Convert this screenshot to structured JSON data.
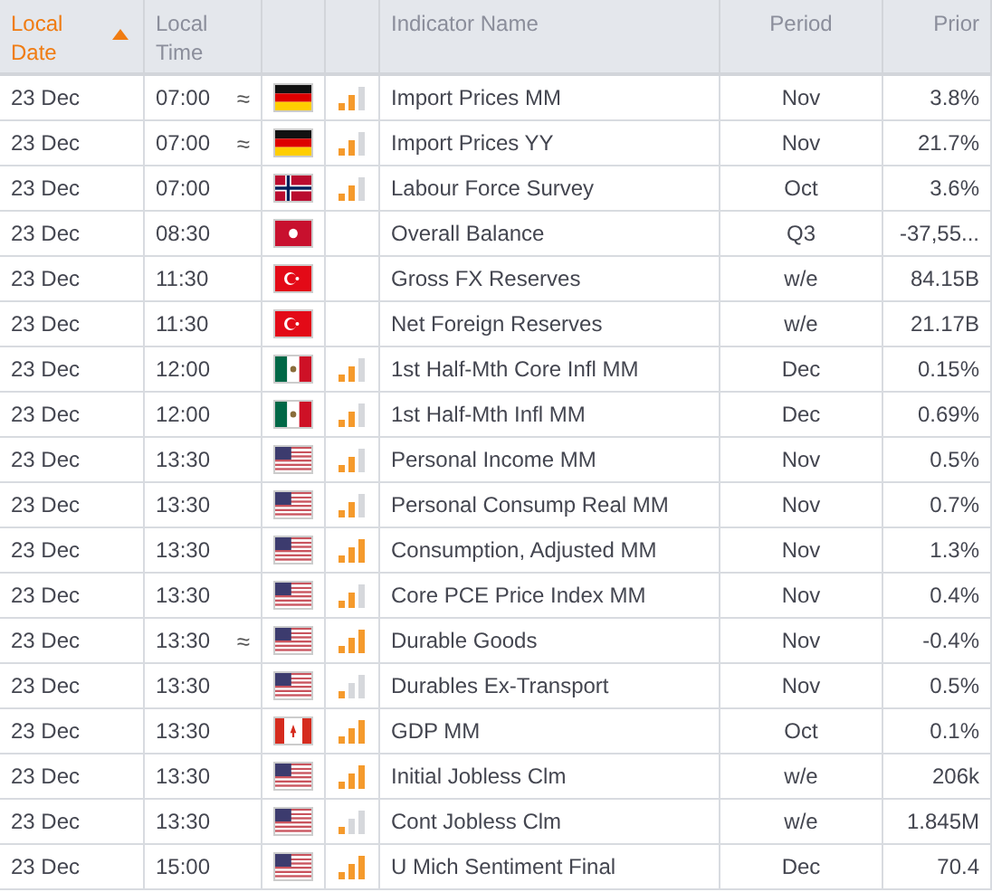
{
  "columns": [
    {
      "label": "Local Date",
      "sorted": true
    },
    {
      "label": "Local Time",
      "sorted": false
    },
    {
      "sorted": false
    },
    {
      "sorted": false
    },
    {
      "label": "Indicator Name",
      "sorted": false
    },
    {
      "label": "Period",
      "sorted": false
    },
    {
      "label": "Prior",
      "sorted": false
    }
  ],
  "rows": [
    {
      "date": "23 Dec",
      "time": "07:00",
      "marker": "≈",
      "flag": {
        "kind": "de"
      },
      "importance": {
        "kind": "medium"
      },
      "name": "Import Prices MM",
      "period": "Nov",
      "prior": "3.8%"
    },
    {
      "date": "23 Dec",
      "time": "07:00",
      "marker": "≈",
      "flag": {
        "kind": "de"
      },
      "importance": {
        "kind": "medium"
      },
      "name": "Import Prices YY",
      "period": "Nov",
      "prior": "21.7%"
    },
    {
      "date": "23 Dec",
      "time": "07:00",
      "flag": {
        "kind": "no"
      },
      "importance": {
        "kind": "medium"
      },
      "name": "Labour Force Survey",
      "period": "Oct",
      "prior": "3.6%"
    },
    {
      "date": "23 Dec",
      "time": "08:30",
      "flag": {
        "kind": "hk"
      },
      "name": "Overall Balance",
      "period": "Q3",
      "prior": "-37,55..."
    },
    {
      "date": "23 Dec",
      "time": "11:30",
      "flag": {
        "kind": "tr"
      },
      "name": "Gross FX Reserves",
      "period": "w/e",
      "prior": "84.15B"
    },
    {
      "date": "23 Dec",
      "time": "11:30",
      "flag": {
        "kind": "tr"
      },
      "name": "Net Foreign Reserves",
      "period": "w/e",
      "prior": "21.17B"
    },
    {
      "date": "23 Dec",
      "time": "12:00",
      "flag": {
        "kind": "mx"
      },
      "importance": {
        "kind": "medium"
      },
      "name": "1st Half-Mth Core Infl MM",
      "period": "Dec",
      "prior": "0.15%"
    },
    {
      "date": "23 Dec",
      "time": "12:00",
      "flag": {
        "kind": "mx"
      },
      "importance": {
        "kind": "medium"
      },
      "name": "1st Half-Mth Infl MM",
      "period": "Dec",
      "prior": "0.69%"
    },
    {
      "date": "23 Dec",
      "time": "13:30",
      "flag": {
        "kind": "us"
      },
      "importance": {
        "kind": "medium"
      },
      "name": "Personal Income MM",
      "period": "Nov",
      "prior": "0.5%"
    },
    {
      "date": "23 Dec",
      "time": "13:30",
      "flag": {
        "kind": "us"
      },
      "importance": {
        "kind": "medium"
      },
      "name": "Personal Consump Real MM",
      "period": "Nov",
      "prior": "0.7%"
    },
    {
      "date": "23 Dec",
      "time": "13:30",
      "flag": {
        "kind": "us"
      },
      "importance": {
        "kind": "high"
      },
      "name": "Consumption, Adjusted MM",
      "period": "Nov",
      "prior": "1.3%"
    },
    {
      "date": "23 Dec",
      "time": "13:30",
      "flag": {
        "kind": "us"
      },
      "importance": {
        "kind": "medium"
      },
      "name": "Core PCE Price Index MM",
      "period": "Nov",
      "prior": "0.4%"
    },
    {
      "date": "23 Dec",
      "time": "13:30",
      "marker": "≈",
      "flag": {
        "kind": "us"
      },
      "importance": {
        "kind": "high"
      },
      "name": "Durable Goods",
      "period": "Nov",
      "prior": "-0.4%"
    },
    {
      "date": "23 Dec",
      "time": "13:30",
      "flag": {
        "kind": "us"
      },
      "importance": {
        "kind": "low"
      },
      "name": "Durables Ex-Transport",
      "period": "Nov",
      "prior": "0.5%"
    },
    {
      "date": "23 Dec",
      "time": "13:30",
      "flag": {
        "kind": "ca"
      },
      "importance": {
        "kind": "high"
      },
      "name": "GDP MM",
      "period": "Oct",
      "prior": "0.1%"
    },
    {
      "date": "23 Dec",
      "time": "13:30",
      "flag": {
        "kind": "us"
      },
      "importance": {
        "kind": "high"
      },
      "name": "Initial Jobless Clm",
      "period": "w/e",
      "prior": "206k"
    },
    {
      "date": "23 Dec",
      "time": "13:30",
      "flag": {
        "kind": "us"
      },
      "importance": {
        "kind": "low"
      },
      "name": "Cont Jobless Clm",
      "period": "w/e",
      "prior": "1.845M"
    },
    {
      "date": "23 Dec",
      "time": "15:00",
      "flag": {
        "kind": "us"
      },
      "importance": {
        "kind": "high"
      },
      "name": "U Mich Sentiment Final",
      "period": "Dec",
      "prior": "70.4"
    }
  ]
}
